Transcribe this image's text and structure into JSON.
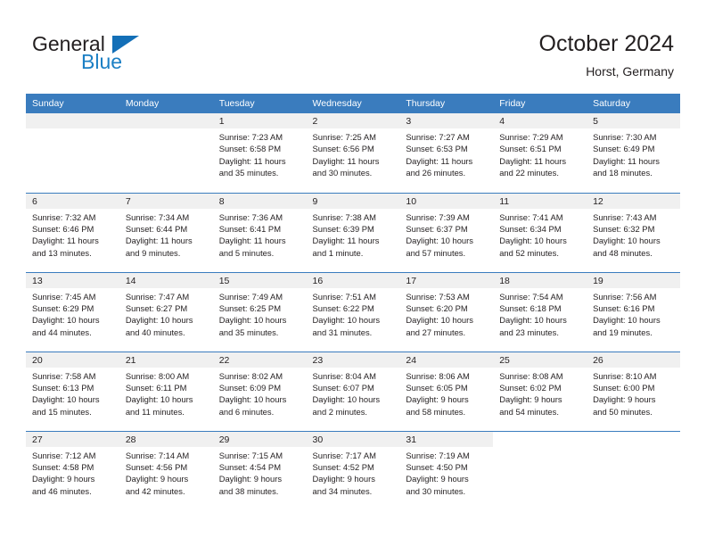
{
  "brand": {
    "name_part1": "General",
    "name_part2": "Blue",
    "logo_icon": "triangle-logo-icon",
    "color_dark": "#231f20",
    "color_blue": "#1b7fc4"
  },
  "header": {
    "title": "October 2024",
    "subtitle": "Horst, Germany"
  },
  "theme": {
    "header_bg": "#3a7cbe",
    "header_text": "#ffffff",
    "daynum_bg": "#f0f0f0",
    "row_divider": "#3a7cbe",
    "body_text": "#231f20"
  },
  "weekday_headers": [
    "Sunday",
    "Monday",
    "Tuesday",
    "Wednesday",
    "Thursday",
    "Friday",
    "Saturday"
  ],
  "weeks": [
    [
      {
        "day": "",
        "lines": []
      },
      {
        "day": "",
        "lines": []
      },
      {
        "day": "1",
        "lines": [
          "Sunrise: 7:23 AM",
          "Sunset: 6:58 PM",
          "Daylight: 11 hours",
          "and 35 minutes."
        ]
      },
      {
        "day": "2",
        "lines": [
          "Sunrise: 7:25 AM",
          "Sunset: 6:56 PM",
          "Daylight: 11 hours",
          "and 30 minutes."
        ]
      },
      {
        "day": "3",
        "lines": [
          "Sunrise: 7:27 AM",
          "Sunset: 6:53 PM",
          "Daylight: 11 hours",
          "and 26 minutes."
        ]
      },
      {
        "day": "4",
        "lines": [
          "Sunrise: 7:29 AM",
          "Sunset: 6:51 PM",
          "Daylight: 11 hours",
          "and 22 minutes."
        ]
      },
      {
        "day": "5",
        "lines": [
          "Sunrise: 7:30 AM",
          "Sunset: 6:49 PM",
          "Daylight: 11 hours",
          "and 18 minutes."
        ]
      }
    ],
    [
      {
        "day": "6",
        "lines": [
          "Sunrise: 7:32 AM",
          "Sunset: 6:46 PM",
          "Daylight: 11 hours",
          "and 13 minutes."
        ]
      },
      {
        "day": "7",
        "lines": [
          "Sunrise: 7:34 AM",
          "Sunset: 6:44 PM",
          "Daylight: 11 hours",
          "and 9 minutes."
        ]
      },
      {
        "day": "8",
        "lines": [
          "Sunrise: 7:36 AM",
          "Sunset: 6:41 PM",
          "Daylight: 11 hours",
          "and 5 minutes."
        ]
      },
      {
        "day": "9",
        "lines": [
          "Sunrise: 7:38 AM",
          "Sunset: 6:39 PM",
          "Daylight: 11 hours",
          "and 1 minute."
        ]
      },
      {
        "day": "10",
        "lines": [
          "Sunrise: 7:39 AM",
          "Sunset: 6:37 PM",
          "Daylight: 10 hours",
          "and 57 minutes."
        ]
      },
      {
        "day": "11",
        "lines": [
          "Sunrise: 7:41 AM",
          "Sunset: 6:34 PM",
          "Daylight: 10 hours",
          "and 52 minutes."
        ]
      },
      {
        "day": "12",
        "lines": [
          "Sunrise: 7:43 AM",
          "Sunset: 6:32 PM",
          "Daylight: 10 hours",
          "and 48 minutes."
        ]
      }
    ],
    [
      {
        "day": "13",
        "lines": [
          "Sunrise: 7:45 AM",
          "Sunset: 6:29 PM",
          "Daylight: 10 hours",
          "and 44 minutes."
        ]
      },
      {
        "day": "14",
        "lines": [
          "Sunrise: 7:47 AM",
          "Sunset: 6:27 PM",
          "Daylight: 10 hours",
          "and 40 minutes."
        ]
      },
      {
        "day": "15",
        "lines": [
          "Sunrise: 7:49 AM",
          "Sunset: 6:25 PM",
          "Daylight: 10 hours",
          "and 35 minutes."
        ]
      },
      {
        "day": "16",
        "lines": [
          "Sunrise: 7:51 AM",
          "Sunset: 6:22 PM",
          "Daylight: 10 hours",
          "and 31 minutes."
        ]
      },
      {
        "day": "17",
        "lines": [
          "Sunrise: 7:53 AM",
          "Sunset: 6:20 PM",
          "Daylight: 10 hours",
          "and 27 minutes."
        ]
      },
      {
        "day": "18",
        "lines": [
          "Sunrise: 7:54 AM",
          "Sunset: 6:18 PM",
          "Daylight: 10 hours",
          "and 23 minutes."
        ]
      },
      {
        "day": "19",
        "lines": [
          "Sunrise: 7:56 AM",
          "Sunset: 6:16 PM",
          "Daylight: 10 hours",
          "and 19 minutes."
        ]
      }
    ],
    [
      {
        "day": "20",
        "lines": [
          "Sunrise: 7:58 AM",
          "Sunset: 6:13 PM",
          "Daylight: 10 hours",
          "and 15 minutes."
        ]
      },
      {
        "day": "21",
        "lines": [
          "Sunrise: 8:00 AM",
          "Sunset: 6:11 PM",
          "Daylight: 10 hours",
          "and 11 minutes."
        ]
      },
      {
        "day": "22",
        "lines": [
          "Sunrise: 8:02 AM",
          "Sunset: 6:09 PM",
          "Daylight: 10 hours",
          "and 6 minutes."
        ]
      },
      {
        "day": "23",
        "lines": [
          "Sunrise: 8:04 AM",
          "Sunset: 6:07 PM",
          "Daylight: 10 hours",
          "and 2 minutes."
        ]
      },
      {
        "day": "24",
        "lines": [
          "Sunrise: 8:06 AM",
          "Sunset: 6:05 PM",
          "Daylight: 9 hours",
          "and 58 minutes."
        ]
      },
      {
        "day": "25",
        "lines": [
          "Sunrise: 8:08 AM",
          "Sunset: 6:02 PM",
          "Daylight: 9 hours",
          "and 54 minutes."
        ]
      },
      {
        "day": "26",
        "lines": [
          "Sunrise: 8:10 AM",
          "Sunset: 6:00 PM",
          "Daylight: 9 hours",
          "and 50 minutes."
        ]
      }
    ],
    [
      {
        "day": "27",
        "lines": [
          "Sunrise: 7:12 AM",
          "Sunset: 4:58 PM",
          "Daylight: 9 hours",
          "and 46 minutes."
        ]
      },
      {
        "day": "28",
        "lines": [
          "Sunrise: 7:14 AM",
          "Sunset: 4:56 PM",
          "Daylight: 9 hours",
          "and 42 minutes."
        ]
      },
      {
        "day": "29",
        "lines": [
          "Sunrise: 7:15 AM",
          "Sunset: 4:54 PM",
          "Daylight: 9 hours",
          "and 38 minutes."
        ]
      },
      {
        "day": "30",
        "lines": [
          "Sunrise: 7:17 AM",
          "Sunset: 4:52 PM",
          "Daylight: 9 hours",
          "and 34 minutes."
        ]
      },
      {
        "day": "31",
        "lines": [
          "Sunrise: 7:19 AM",
          "Sunset: 4:50 PM",
          "Daylight: 9 hours",
          "and 30 minutes."
        ]
      },
      {
        "day": "",
        "lines": []
      },
      {
        "day": "",
        "lines": []
      }
    ]
  ]
}
